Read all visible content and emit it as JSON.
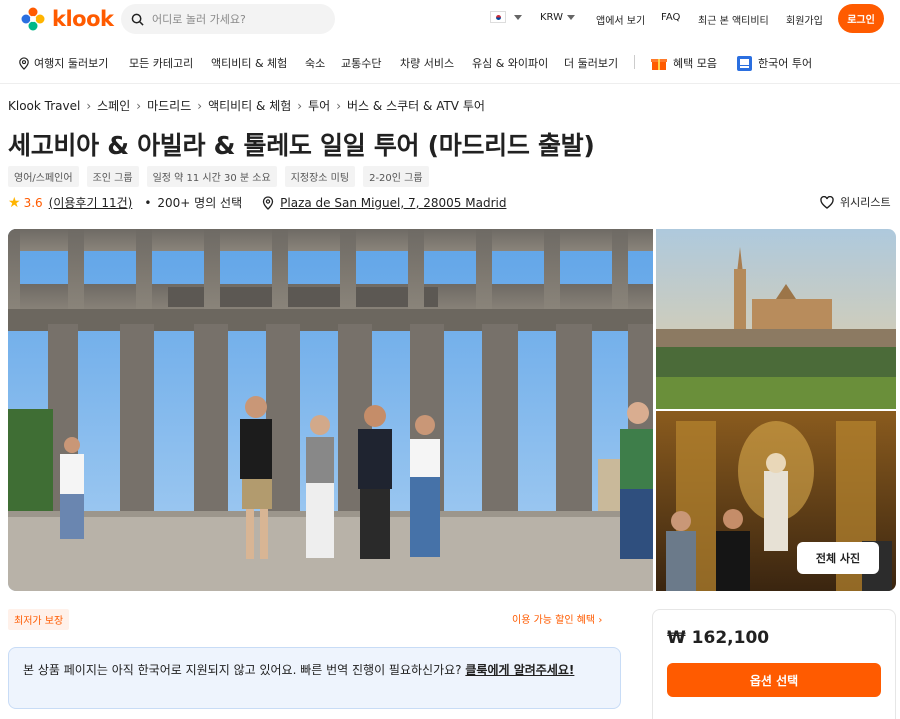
{
  "header": {
    "logo_text": "klook",
    "search_placeholder": "어디로 놀러 가세요?",
    "currency": "KRW",
    "app_download": "앱에서 보기",
    "faq": "FAQ",
    "recently_viewed": "최근 본 액티비티",
    "signup": "회원가입",
    "login": "로그인"
  },
  "nav": {
    "items": [
      {
        "label": "여행지 둘러보기"
      },
      {
        "label": "모든 카테고리"
      },
      {
        "label": "액티비티 & 체험"
      },
      {
        "label": "숙소"
      },
      {
        "label": "교통수단"
      },
      {
        "label": "차량 서비스"
      },
      {
        "label": "유심 & 와이파이"
      },
      {
        "label": "더 둘러보기"
      },
      {
        "label": "혜택 모음"
      },
      {
        "label": "한국어 투어"
      }
    ]
  },
  "breadcrumb": [
    "Klook Travel",
    "스페인",
    "마드리드",
    "액티비티 & 체험",
    "투어",
    "버스 & 스쿠터 & ATV 투어"
  ],
  "title": "세고비아 & 아빌라 & 톨레도 일일 투어 (마드리드 출발)",
  "tags": [
    "영어/스페인어",
    "조인 그룹",
    "일정 약 11 시간 30 분 소요",
    "지정장소 미팅",
    "2-20인 그룹"
  ],
  "meta": {
    "rating": "3.6",
    "reviews": "(이용후기 11건)",
    "booked": "200+ 명의 선택",
    "location": "Plaza de San Miguel, 7, 28005 Madrid",
    "wishlist": "위시리스트"
  },
  "gallery": {
    "all_photos": "전체 사진"
  },
  "best_price": "최저가 보장",
  "discount_link": "이용 가능 할인 혜택",
  "notice": {
    "text": "본 상품 페이지는 아직 한국어로 지원되지 않고 있어요. 빠른 번역 진행이 필요하신가요? ",
    "link": "클룩에게 알려주세요!"
  },
  "price_card": {
    "price": "₩ 162,100",
    "select_label": "옵션 선택"
  },
  "colors": {
    "brand": "#ff5b00",
    "notice_bg": "#eef4fd",
    "star": "#ffb400"
  }
}
